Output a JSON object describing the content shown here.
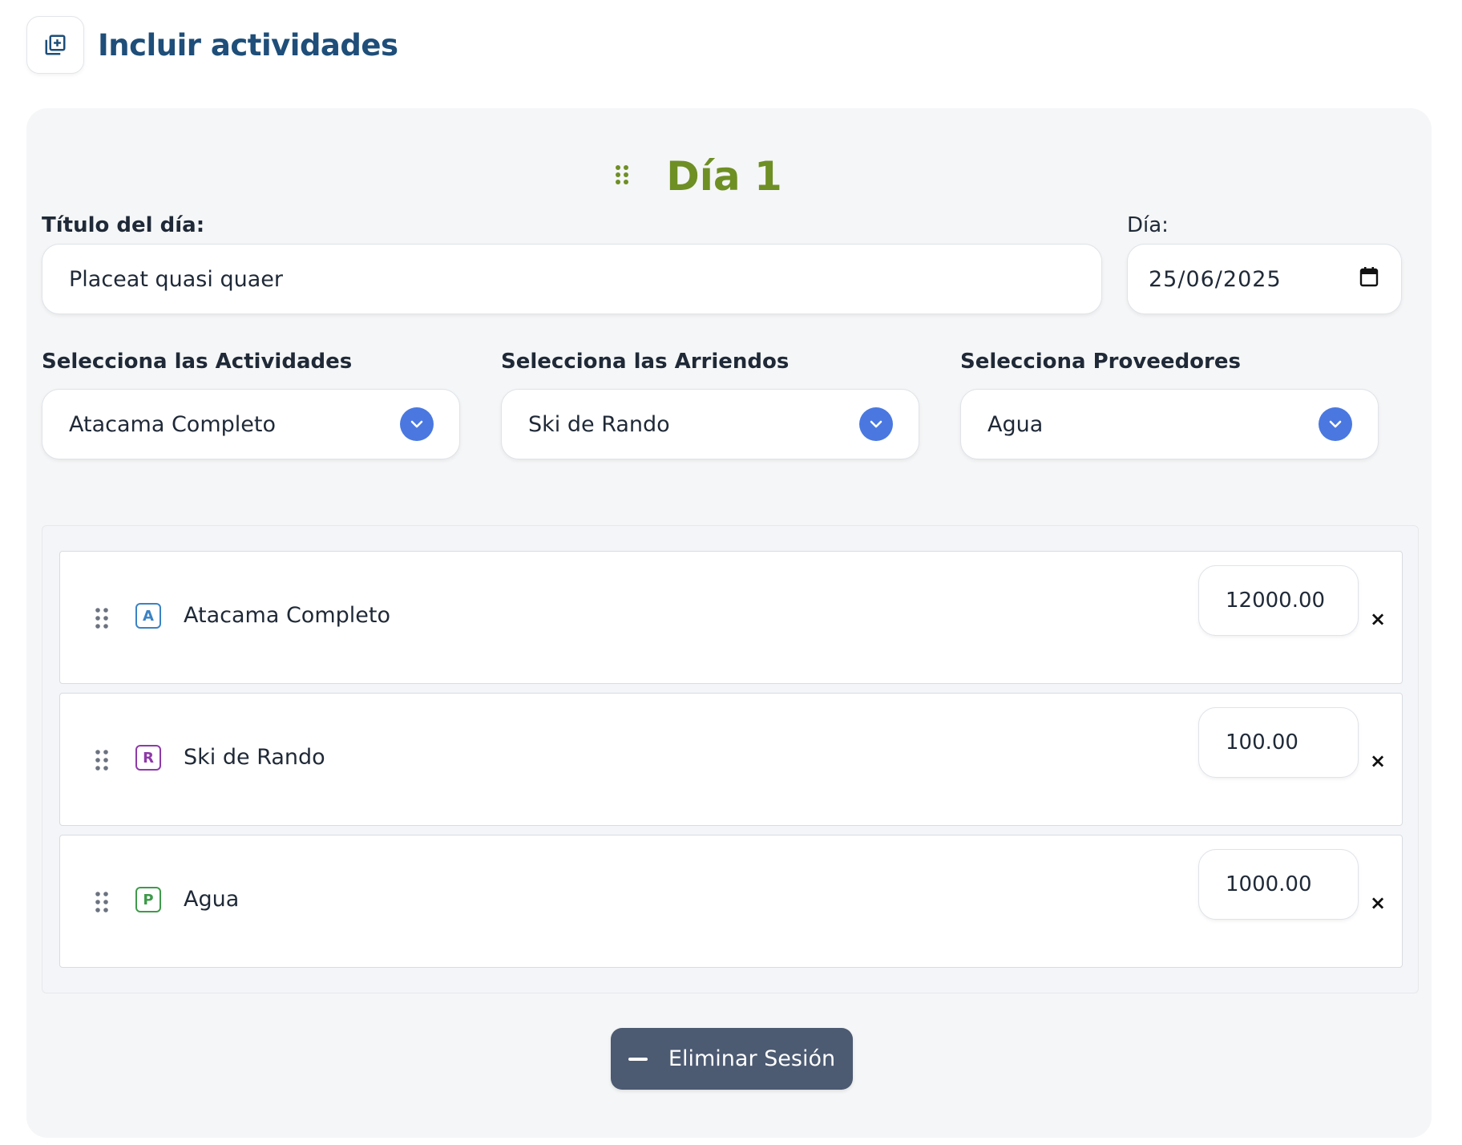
{
  "header": {
    "title": "Incluir actividades",
    "icon": "add-to-library-icon"
  },
  "day": {
    "title": "Día 1",
    "title_label": "Título del día:",
    "title_value": "Placeat quasi quaer",
    "date_label": "Día:",
    "date_value": "25/06/2025"
  },
  "selects": {
    "activities": {
      "label": "Selecciona las Actividades",
      "value": "Atacama Completo"
    },
    "rentals": {
      "label": "Selecciona las Arriendos",
      "value": "Ski de Rando"
    },
    "providers": {
      "label": "Selecciona Proveedores",
      "value": "Agua"
    }
  },
  "items": [
    {
      "badge": "A",
      "name": "Atacama Completo",
      "price": "12000.00",
      "badge_color": "#3b82c4"
    },
    {
      "badge": "R",
      "name": "Ski de Rando",
      "price": "100.00",
      "badge_color": "#8e3aa8"
    },
    {
      "badge": "P",
      "name": "Agua",
      "price": "1000.00",
      "badge_color": "#3f9a4a"
    }
  ],
  "remove_symbol": "×",
  "delete_button": {
    "label": "Eliminar Sesión"
  },
  "colors": {
    "accent_green": "#6e8f24",
    "header_blue": "#1e4e79",
    "chevron_blue": "#4a78e0",
    "button_slate": "#4c5a72"
  }
}
